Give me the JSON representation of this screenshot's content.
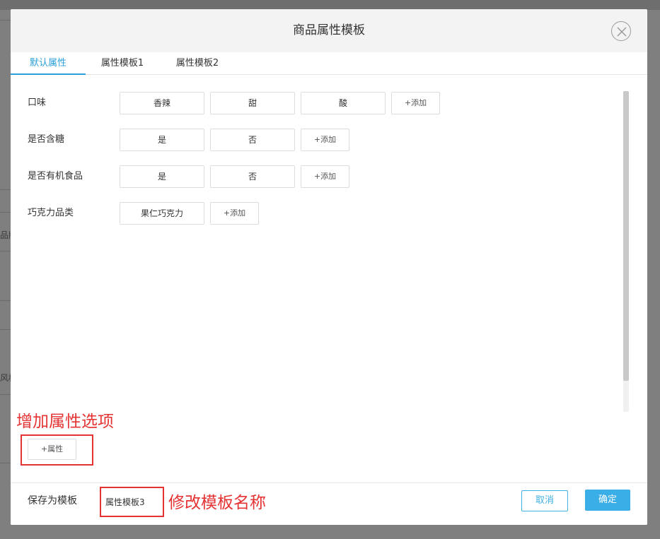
{
  "background": {
    "side_texts": [
      "品牌",
      "风格"
    ]
  },
  "dialog": {
    "title": "商品属性模板",
    "close_icon": "close-circle-icon",
    "tabs": [
      {
        "label": "默认属性",
        "active": true
      },
      {
        "label": "属性模板1",
        "active": false
      },
      {
        "label": "属性模板2",
        "active": false
      }
    ],
    "attributes": [
      {
        "label": "口味",
        "options": [
          "香辣",
          "甜",
          "酸"
        ],
        "add_label": "+添加"
      },
      {
        "label": "是否含糖",
        "options": [
          "是",
          "否"
        ],
        "add_label": "+添加"
      },
      {
        "label": "是否有机食品",
        "options": [
          "是",
          "否"
        ],
        "add_label": "+添加"
      },
      {
        "label": "巧克力品类",
        "options": [
          "果仁巧克力"
        ],
        "add_label": "+添加"
      }
    ],
    "add_attribute_label": "+属性",
    "footer": {
      "save_as_template_label": "保存为模板",
      "template_name_value": "属性模板3",
      "cancel_label": "取消",
      "confirm_label": "确定"
    }
  },
  "annotations": {
    "add_option": "增加属性选项",
    "rename_template": "修改模板名称",
    "color": "#e53333"
  },
  "colors": {
    "accent": "#2b9ed8",
    "confirm_bg": "#3aaee6"
  }
}
